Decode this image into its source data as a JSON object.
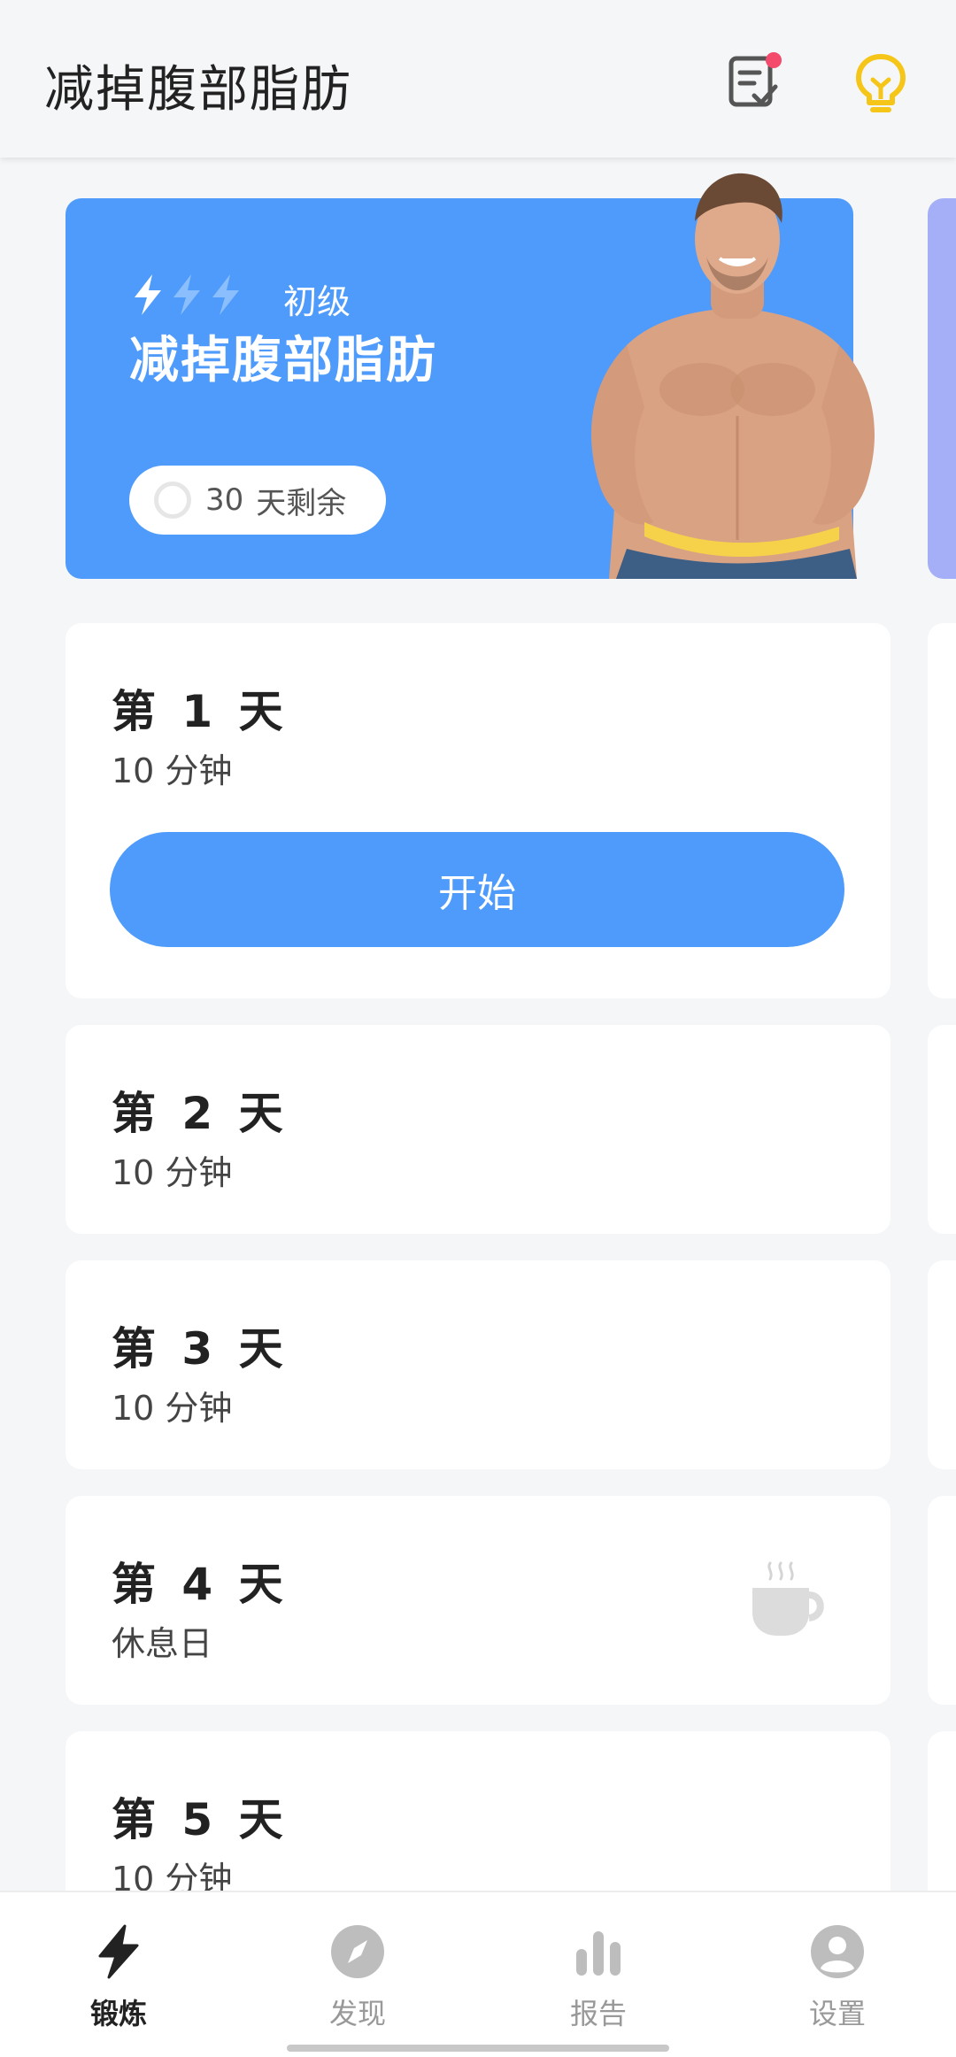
{
  "header": {
    "title": "减掉腹部脂肪",
    "plan_icon": "checklist-icon",
    "tip_icon": "lightbulb-icon"
  },
  "banner": {
    "level": "初级",
    "title": "减掉腹部脂肪",
    "days_num": "30",
    "days_text": "天剩余",
    "color": "#4e9bfb"
  },
  "days": [
    {
      "title": "第 1 天",
      "sub": "10 分钟",
      "button": "开始"
    },
    {
      "title": "第 2 天",
      "sub": "10 分钟"
    },
    {
      "title": "第 3 天",
      "sub": "10 分钟"
    },
    {
      "title": "第 4 天",
      "sub": "休息日",
      "icon": "coffee-cup-icon"
    },
    {
      "title": "第 5 天",
      "sub": "10 分钟"
    }
  ],
  "nav": [
    {
      "label": "锻炼",
      "icon": "lightning-icon",
      "active": true
    },
    {
      "label": "发现",
      "icon": "compass-icon"
    },
    {
      "label": "报告",
      "icon": "bar-chart-icon"
    },
    {
      "label": "设置",
      "icon": "user-icon"
    }
  ],
  "colors": {
    "accent": "#4e9bfb",
    "tip": "#f5c518",
    "badge": "#f44b6c"
  }
}
